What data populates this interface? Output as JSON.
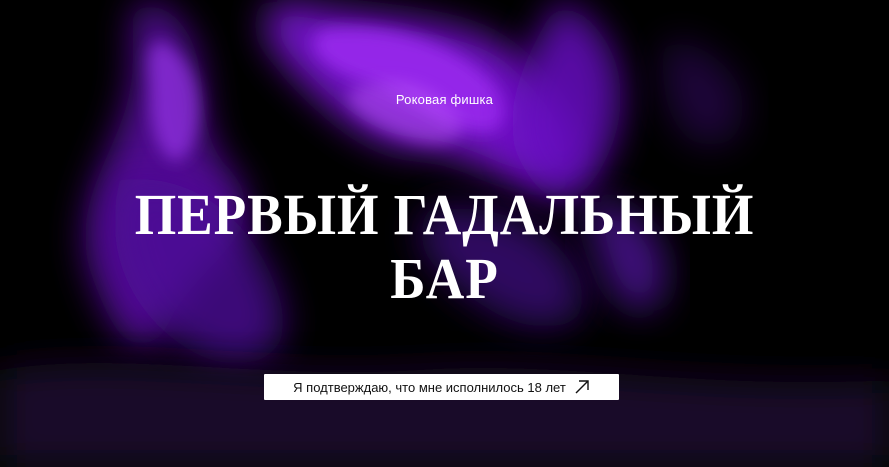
{
  "hero": {
    "subtitle": "Роковая фишка",
    "title_line_1": "ПЕРВЫЙ ГАДАЛЬНЫЙ",
    "title_line_2": "БАР"
  },
  "confirm_button": {
    "label": "Я подтверждаю, что мне исполнилось 18 лет",
    "icon": "arrow-up-right-icon"
  },
  "colors": {
    "background": "#000000",
    "accent_purple": "#8a1fe0",
    "text": "#ffffff",
    "button_bg": "#ffffff",
    "button_text": "#111111"
  }
}
